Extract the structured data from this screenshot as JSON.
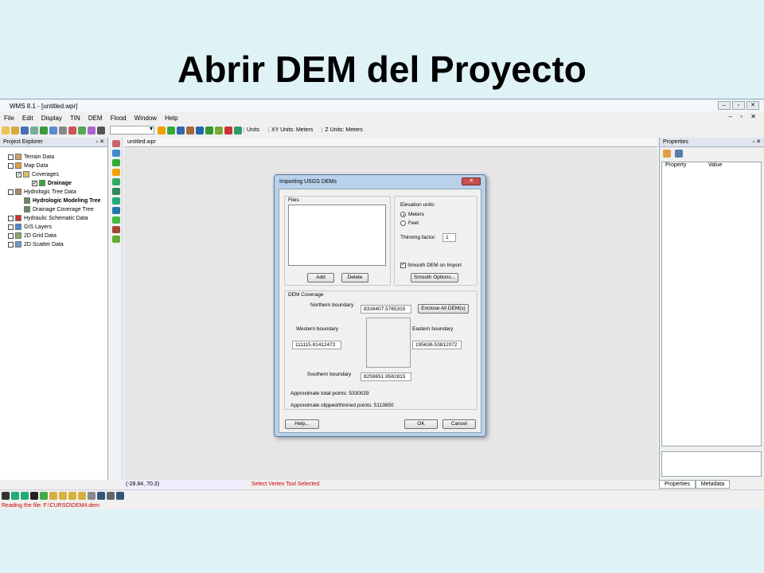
{
  "slide": {
    "title": "Abrir DEM del Proyecto"
  },
  "app": {
    "window_title": "WMS 8.1 - [untitled.wpr]",
    "menu": [
      "File",
      "Edit",
      "Display",
      "TIN",
      "DEM",
      "Flood",
      "Window",
      "Help"
    ],
    "toolbar": {
      "units": "Units",
      "xy_units": "XY Units: Meters",
      "z_units": "Z Units: Meters"
    },
    "explorer": {
      "title": "Project Explorer",
      "items": [
        "Terrain Data",
        "Map Data",
        "Coverages",
        "Drainage",
        "Hydrologic Tree Data",
        "Hydrologic Modeling Tree",
        "Drainage Coverage Tree",
        "Hydraulic Schematic Data",
        "GIS Layers",
        "2D Grid Data",
        "2D Scatter Data"
      ]
    },
    "doc_tab": "untitled.wpr",
    "properties": {
      "title": "Properties",
      "col_property": "Property",
      "col_value": "Value",
      "tab_properties": "Properties",
      "tab_metadata": "Metadata"
    },
    "status": {
      "coords": "(-28.84, 70.3)",
      "tool": "Select Vertex Tool Selected"
    },
    "message": "Reading the file: F:\\CURSO\\DEM4.dem"
  },
  "dialog": {
    "title": "Importing USGS DEMs",
    "files_label": "Files",
    "add": "Add",
    "delete": "Delete",
    "elevation_units_label": "Elevation units:",
    "meters": "Meters",
    "feet": "Feet",
    "thinning_label": "Thinning factor:",
    "thinning_value": "1",
    "smooth_label": "Smooth DEM on Import",
    "smooth_options": "Smooth Options...",
    "coverage_label": "DEM Coverage",
    "north_label": "Northern boundary",
    "north_value": "8316407.5765315",
    "enclose": "Enclose All DEM(s)",
    "west_label": "Western boundary",
    "west_value": "111115.81412472",
    "east_label": "Eastern boundary",
    "east_value": "195636.53812072",
    "south_label": "Southern boundary",
    "south_value": "8259651.9562815",
    "total_points": "Approximate total points: 5330029",
    "clipped_points": "Approximate clipped/thinned points: 5113650",
    "help": "Help...",
    "ok": "OK",
    "cancel": "Cancel"
  },
  "colors": {
    "background": "#dff3f6",
    "status_red": "#cc0000",
    "dialog_frame": "#b9d1ea"
  }
}
